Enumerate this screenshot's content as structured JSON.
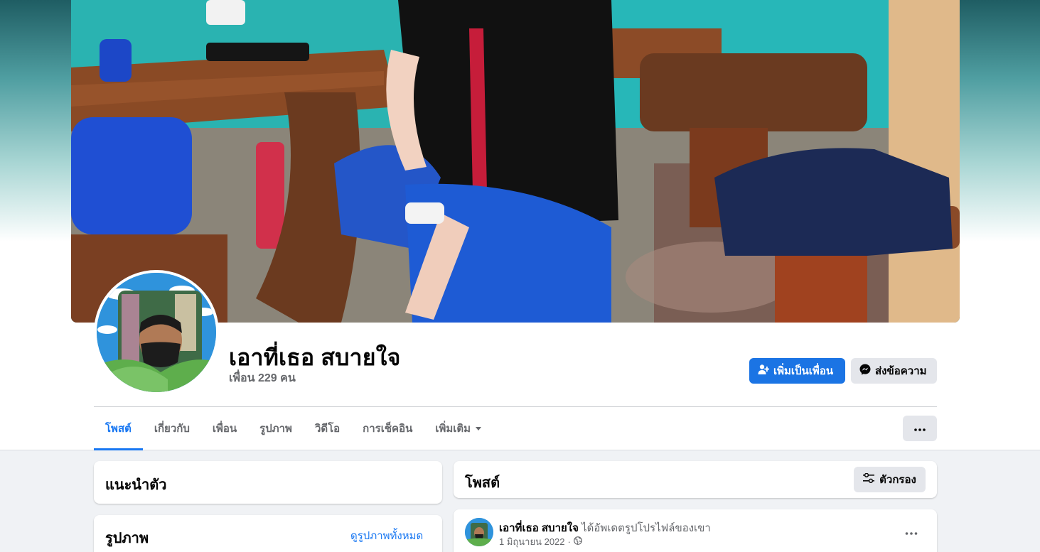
{
  "profile": {
    "name": "เอาที่เธอ สบายใจ",
    "friends": "เพื่อน 229 คน"
  },
  "actions": {
    "add_friend": "เพิ่มเป็นเพื่อน",
    "message": "ส่งข้อความ"
  },
  "tabs": [
    {
      "label": "โพสต์",
      "active": true
    },
    {
      "label": "เกี่ยวกับ"
    },
    {
      "label": "เพื่อน"
    },
    {
      "label": "รูปภาพ"
    },
    {
      "label": "วิดีโอ"
    },
    {
      "label": "การเช็คอิน"
    },
    {
      "label": "เพิ่มเติม"
    }
  ],
  "intro": {
    "title": "แนะนำตัว"
  },
  "photos": {
    "title": "รูปภาพ",
    "see_all": "ดูรูปภาพทั้งหมด"
  },
  "posts": {
    "title": "โพสต์",
    "filter": "ตัวกรอง"
  },
  "post": {
    "author": "เอาที่เธอ สบายใจ",
    "action": "ได้อัพเดตรูปโปรไฟล์ของเขา",
    "date": "1 มิถุนายน 2022",
    "separator": "·"
  },
  "colors": {
    "accent": "#1877f2",
    "primary_button": "#1b74e4",
    "secondary_button": "#e4e6eb",
    "page_bg": "#f0f2f5"
  },
  "icons": {
    "add_friend": "person-plus-icon",
    "message": "messenger-icon",
    "more": "ellipsis-icon",
    "dropdown": "caret-down-icon",
    "filter": "sliders-icon",
    "privacy": "globe-icon"
  }
}
